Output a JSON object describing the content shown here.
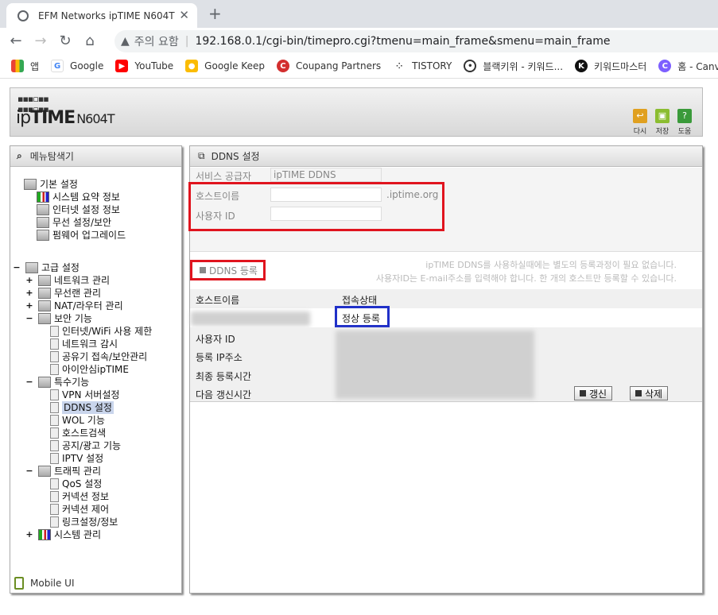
{
  "browser": {
    "tab_title": "EFM Networks ipTIME N604T",
    "security_label": "주의 요함",
    "url": "192.168.0.1/cgi-bin/timepro.cgi?tmenu=main_frame&smenu=main_frame",
    "bookmarks": [
      "앱",
      "Google",
      "YouTube",
      "Google Keep",
      "Coupang Partners",
      "TISTORY",
      "블랙키위 - 키워드...",
      "키워드마스터",
      "홈 - Canva"
    ]
  },
  "header": {
    "logo_ip": "ip",
    "logo_time": "TIME",
    "logo_model": "N604T",
    "buttons": [
      "다시",
      "저장",
      "도움"
    ]
  },
  "left": {
    "title": "메뉴탐색기",
    "basic_group": "기본 설정",
    "basic_items": [
      "시스템 요약 정보",
      "인터넷 설정 정보",
      "무선 설정/보안",
      "펌웨어 업그레이드"
    ],
    "advanced_group": "고급 설정",
    "advanced_items": [
      "네트워크 관리",
      "무선랜 관리",
      "NAT/라우터 관리",
      "보안 기능"
    ],
    "security_items": [
      "인터넷/WiFi 사용 제한",
      "네트워크 감시",
      "공유기 접속/보안관리",
      "아이안심ipTIME"
    ],
    "special_group": "특수기능",
    "special_items": [
      "VPN 서버설정",
      "DDNS 설정",
      "WOL 기능",
      "호스트검색",
      "공지/광고 기능",
      "IPTV 설정"
    ],
    "traffic_group": "트래픽 관리",
    "traffic_items": [
      "QoS 설정",
      "커넥션 정보",
      "커넥션 제어",
      "링크설정/정보"
    ],
    "system_group": "시스템 관리",
    "mobile_ui": "Mobile UI"
  },
  "right": {
    "title": "DDNS 설정",
    "service_provider_label": "서비스 공급자",
    "service_provider_value": "ipTIME DDNS",
    "hostname_label": "호스트이름",
    "hostname_suffix": ".iptime.org",
    "userid_label": "사용자 ID",
    "register_button": "DDNS 등록",
    "note_line1": "ipTIME DDNS를 사용하실때에는 별도의 등록과정이 필요 없습니다.",
    "note_line2": "사용자ID는 E-mail주소를 입력해야 합니다. 한 개의 호스트만 등록할 수 있습니다.",
    "grid_hostname": "호스트이름",
    "grid_status": "접속상태",
    "status_value": "정상 등록",
    "grid_userid": "사용자 ID",
    "grid_ip": "등록 IP주소",
    "grid_last": "최종 등록시간",
    "grid_next": "다음 갱신시간",
    "refresh_button": "갱신",
    "delete_button": "삭제"
  }
}
